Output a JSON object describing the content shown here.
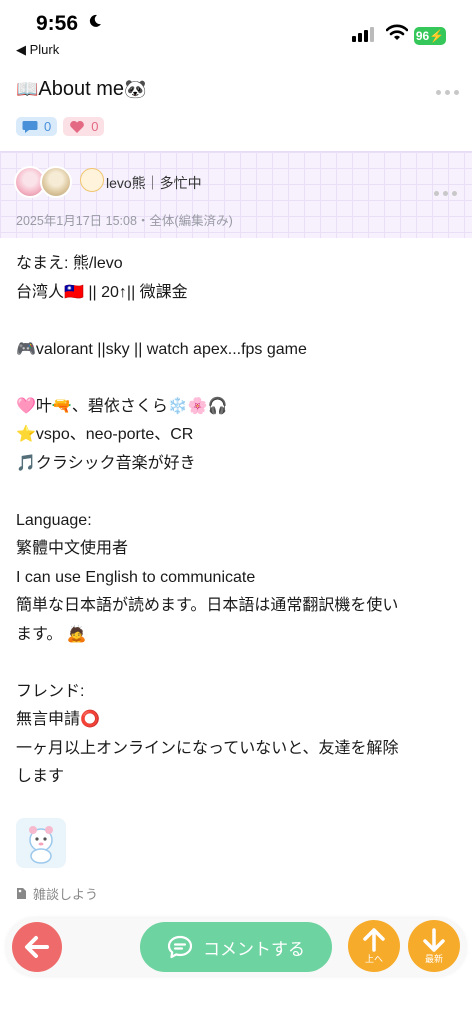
{
  "status_bar": {
    "time": "9:56",
    "back_app": "◀ Plurk",
    "battery": "96"
  },
  "header": {
    "title_emoji_left": "📖",
    "title": "About me",
    "title_emoji_right": "🐼",
    "response_count": "0",
    "like_count": "0"
  },
  "poster": {
    "name": "levo熊｜多忙中",
    "meta": "2025年1月17日 15:08・全体(編集済み)"
  },
  "content": {
    "lines": [
      "なまえ: 熊/levo",
      "台湾人🇹🇼 || 20↑|| 微課金",
      "",
      "🎮valorant ||sky || watch apex...fps game",
      "",
      "🩷叶🔫、碧依さくら❄️🌸🎧",
      "⭐vspo、neo-porte、CR",
      "🎵クラシック音楽が好き",
      "",
      "Language:",
      "繁體中文使用者",
      "I can use English to communicate",
      "簡単な日本語が読めます。日本語は通常翻訳機を使い",
      "ます。 🙇",
      "",
      "フレンド:",
      "無言申請⭕",
      "一ヶ月以上オンラインになっていないと、友達を解除",
      "します"
    ],
    "tag": "雑談しよう"
  },
  "bottom_bar": {
    "comment_label": "コメントする",
    "up_label": "上へ",
    "latest_label": "最新"
  },
  "colors": {
    "like": "#e36a82",
    "response": "#4a90d9",
    "comment_button": "#6dd3a0",
    "back_button": "#ef6b6b",
    "nav_button": "#f7ab2a",
    "poster_bg": "#f6f1fc",
    "battery": "#35c759"
  }
}
